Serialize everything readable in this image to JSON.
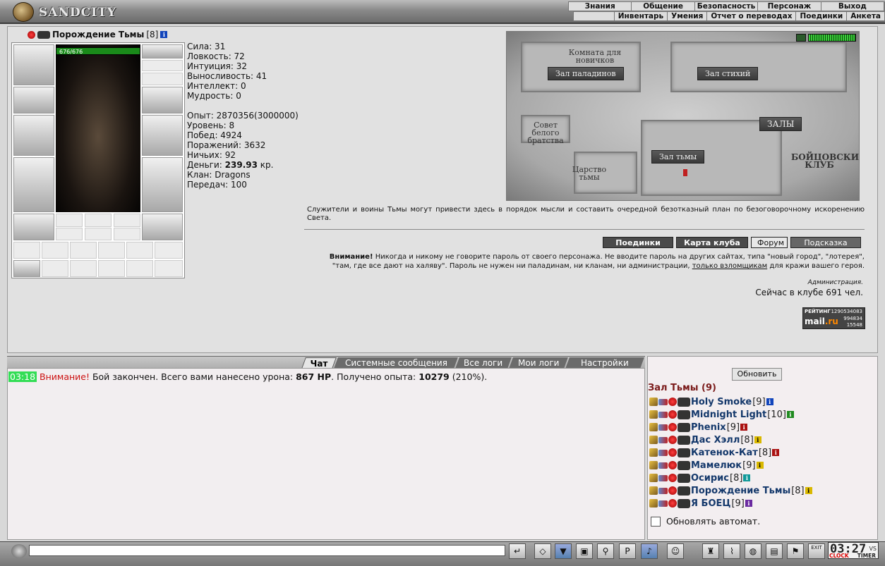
{
  "app": {
    "logo": "SANDCITY"
  },
  "menu_top": [
    "Знания",
    "Общение",
    "Безопасность",
    "Персонаж",
    "Выход"
  ],
  "menu_sub": [
    "Инвентарь",
    "Умения",
    "Отчет о переводах",
    "Поединки",
    "Анкета"
  ],
  "character": {
    "name": "Порождение Тьмы",
    "level": "[8]",
    "hp": "676/676",
    "stats": [
      "Сила: 31",
      "Ловкость: 72",
      "Интуиция: 32",
      "Выносливость: 41",
      "Интеллект: 0",
      "Мудрость: 0"
    ],
    "exp": "Опыт: 2870356(3000000)",
    "level_text": "Уровень: 8",
    "wins": "Побед: 4924",
    "losses": "Поражений: 3632",
    "draws": "Ничьих: 92",
    "money_label": "Деньги: ",
    "money_value": "239.93",
    "money_unit": " кр.",
    "clan": "Клан: Dragons",
    "transfers": "Передач: 100"
  },
  "map": {
    "rooms": {
      "newbies": "Комната для новичков",
      "paladins": "Зал паладинов",
      "elements": "Зал стихий",
      "white_council": "Совет белого братства",
      "halls": "ЗАЛЫ",
      "darkness": "Зал тьмы",
      "kingdom": "Царство тьмы",
      "club": "БОЙЦОВСКИЙ КЛУБ"
    }
  },
  "description": "Служители и воины Тьмы могут привести здесь в порядок мысли и составить очередной безотказный план по безоговорочному искоренению Света.",
  "buttons": {
    "fights": "Поединки",
    "club_map": "Карта клуба",
    "forum": "Форум",
    "hint": "Подсказка"
  },
  "warning": {
    "bold": "Внимание!",
    "text1": " Никогда и никому не говорите пароль от своего персонажа. Не вводите пароль на других сайтах, типа \"новый город\", \"лотерея\", \"там, где все дают на халяву\". Пароль не нужен ни паладинам, ни кланам, ни администрации, ",
    "link": "только взломщикам",
    "text2": " для кражи вашего героя."
  },
  "admin": "Администрация.",
  "online": "Сейчас в клубе 691 чел.",
  "counter": {
    "title": "РЕЙТИНГ",
    "brand": "mail",
    "brand_tld": ".ru",
    "n1": "1290534083",
    "n2": "994834",
    "n3": "15548"
  },
  "chat_tabs": [
    "Чат",
    "Системные сообщения",
    "Все логи",
    "Мои логи",
    "Настройки"
  ],
  "chat": {
    "time": "03:18",
    "attention": "Внимание!",
    "text1": " Бой закончен. Всего вами нанесено урона: ",
    "damage": "867 HP",
    "text2": ". Получено опыта: ",
    "exp": "10279",
    "text3": " (210%)."
  },
  "sidebar": {
    "refresh": "Обновить",
    "room_title": "Зал Тьмы (9)",
    "players": [
      {
        "name": "Holy Smoke",
        "level": "[9]",
        "info": "b"
      },
      {
        "name": "Midnight Light",
        "level": "[10]",
        "info": "g"
      },
      {
        "name": "Phenix",
        "level": "[9]",
        "info": "r"
      },
      {
        "name": "Дас Хэлл",
        "level": "[8]",
        "info": "y"
      },
      {
        "name": "Катенок-Кат",
        "level": "[8]",
        "info": "r"
      },
      {
        "name": "Мамелюк",
        "level": "[9]",
        "info": "y"
      },
      {
        "name": "Осирис",
        "level": "[8]",
        "info": "c"
      },
      {
        "name": "Порождение Тьмы",
        "level": "[8]",
        "info": "y"
      },
      {
        "name": "Я БОЕЦ",
        "level": "[9]",
        "info": "p"
      }
    ],
    "auto_refresh": "Обновлять автомат."
  },
  "clock": {
    "time": "03:27",
    "vs": "VS",
    "label1": "CLOCK",
    "label2": "TIMER"
  },
  "exit_label": "EXIT"
}
